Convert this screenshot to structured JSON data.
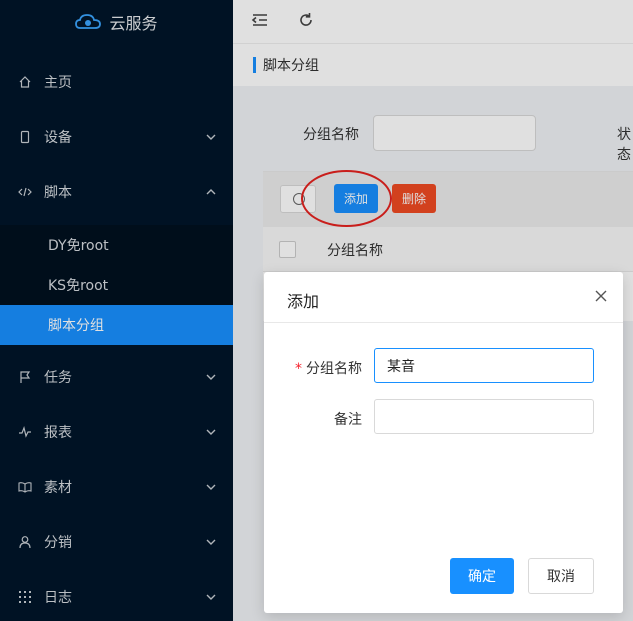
{
  "app": {
    "title": "云服务"
  },
  "sidebar": {
    "items": [
      {
        "label": "主页",
        "icon": "home-icon"
      },
      {
        "label": "设备",
        "icon": "device-icon"
      },
      {
        "label": "脚本",
        "icon": "code-icon"
      },
      {
        "label": "任务",
        "icon": "flag-icon"
      },
      {
        "label": "报表",
        "icon": "pulse-icon"
      },
      {
        "label": "素材",
        "icon": "book-icon"
      },
      {
        "label": "分销",
        "icon": "user-icon"
      },
      {
        "label": "日志",
        "icon": "grid-icon"
      }
    ],
    "script_submenu": [
      {
        "label": "DY免root"
      },
      {
        "label": "KS免root"
      },
      {
        "label": "脚本分组",
        "active": true
      }
    ]
  },
  "breadcrumb": {
    "current": "脚本分组"
  },
  "filter": {
    "group_name_label": "分组名称",
    "status_label": "状态"
  },
  "table": {
    "add_label": "添加",
    "delete_label": "删除",
    "columns": [
      "分组名称"
    ]
  },
  "modal": {
    "title": "添加",
    "group_name_label": "分组名称",
    "group_name_value": "某音",
    "remark_label": "备注",
    "remark_value": "",
    "ok_label": "确定",
    "cancel_label": "取消"
  },
  "colors": {
    "sidebar_bg": "#001529",
    "accent": "#1890ff",
    "danger": "#f04a23",
    "annotation": "#e5231f"
  }
}
